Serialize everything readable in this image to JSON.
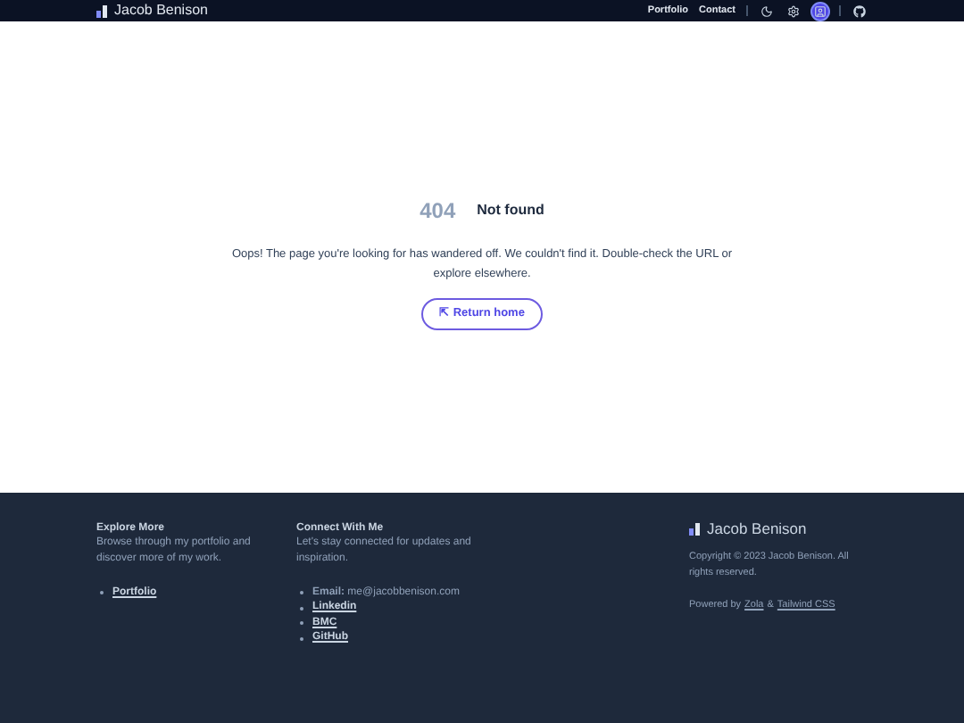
{
  "header": {
    "logo": "Jacob Benison",
    "nav": [
      "Portfolio",
      "Contact"
    ],
    "tools": [
      {
        "kind": "theme",
        "selected": false
      },
      {
        "kind": "settings",
        "selected": false
      },
      {
        "kind": "reader",
        "selected": true
      },
      {
        "kind": "github",
        "selected": false
      }
    ]
  },
  "error": {
    "code": "404",
    "title": "Not found",
    "message": "Oops! The page you're looking for has wandered off. We couldn't find it. Double-check the URL or explore elsewhere.",
    "button": "⇱ Return home"
  },
  "footer": {
    "columns": [
      {
        "title": "Explore More",
        "text": "Browse through my portfolio and discover more of my work.",
        "links": [
          {
            "text": "Portfolio",
            "kind": "link"
          }
        ]
      },
      {
        "title": "Connect With Me",
        "text": "Let's stay connected for updates and inspiration.",
        "links": [
          {
            "text": "**Email:** me@jacobbenison.com",
            "kind": "text"
          },
          {
            "text": "Linkedin",
            "kind": "link"
          },
          {
            "text": "BMC",
            "kind": "link"
          },
          {
            "text": "GitHub",
            "kind": "link"
          }
        ]
      }
    ],
    "brand": "Jacob Benison",
    "copyright": "Copyright © 2023 Jacob Benison. All rights reserved.",
    "powered": [
      "Powered by",
      "Zola",
      "&",
      "Tailwind CSS"
    ]
  }
}
